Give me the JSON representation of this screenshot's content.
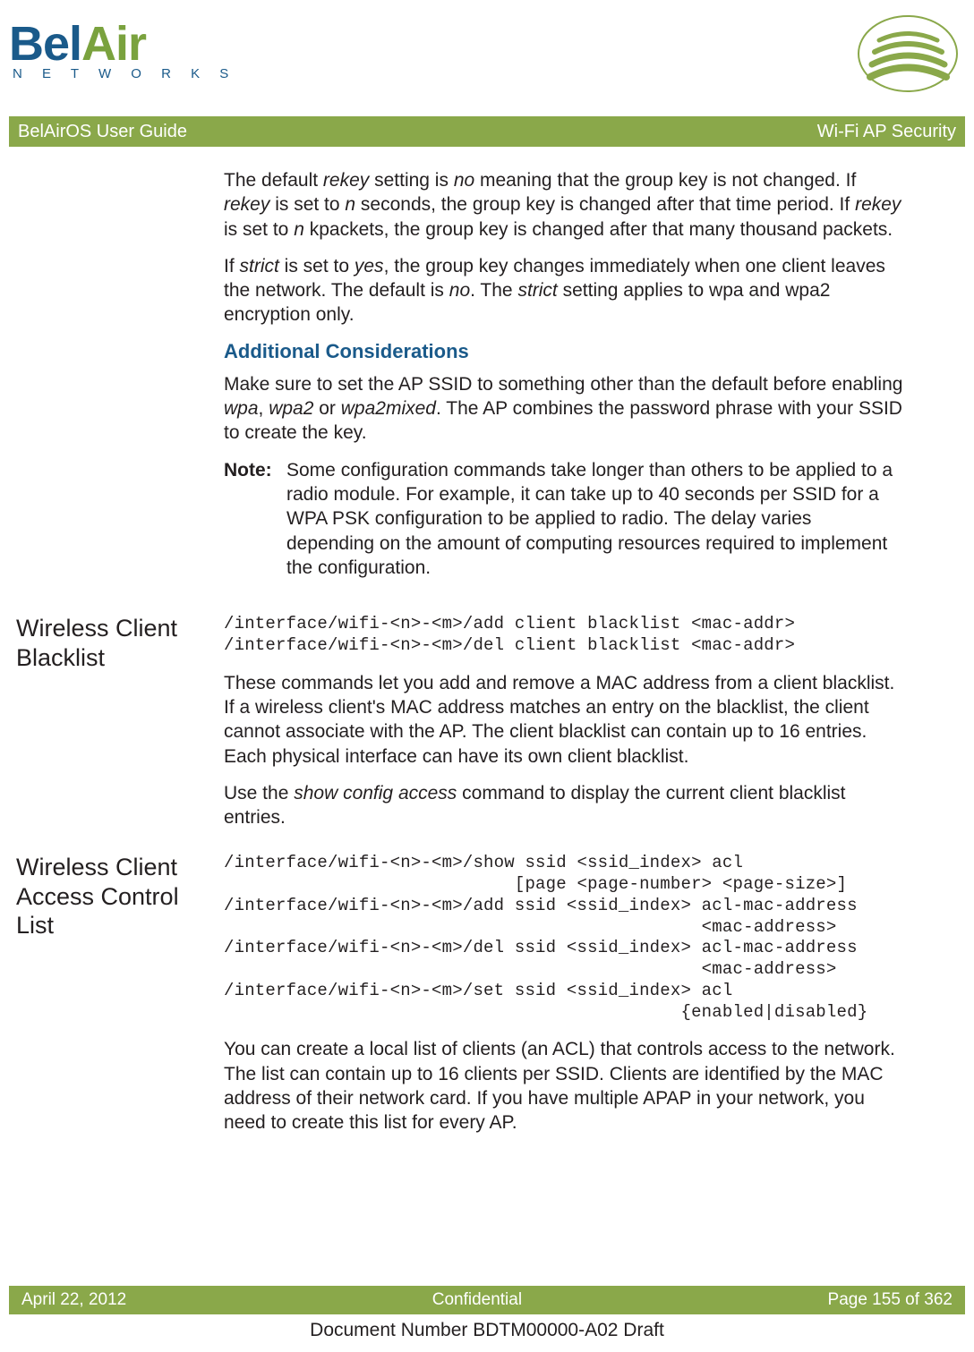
{
  "logo": {
    "bel": "Bel",
    "air": "Air",
    "networks": "N E T W O R K S"
  },
  "titleBar": {
    "left": "BelAirOS User Guide",
    "right": "Wi-Fi AP Security"
  },
  "intro": {
    "p1a": "The default ",
    "p1b": "rekey",
    "p1c": " setting is ",
    "p1d": "no",
    "p1e": " meaning that the group key is not changed. If ",
    "p1f": "rekey",
    "p1g": " is set to ",
    "p1h": "n",
    "p1i": " seconds, the group key is changed after that time period. If ",
    "p1j": "rekey",
    "p1k": " is set to ",
    "p1l": "n",
    "p1m": " kpackets, the group key is changed after that many thousand packets.",
    "p2a": "If ",
    "p2b": "strict",
    "p2c": " is set to ",
    "p2d": "yes",
    "p2e": ", the group key changes immediately when one client leaves the network. The default is ",
    "p2f": "no",
    "p2g": ". The ",
    "p2h": "strict",
    "p2i": " setting applies to wpa and wpa2 encryption only."
  },
  "additional": {
    "heading": "Additional Considerations",
    "p1a": "Make sure to set the AP SSID to something other than the default before enabling ",
    "p1b": "wpa",
    "p1c": ", ",
    "p1d": "wpa2",
    "p1e": " or ",
    "p1f": "wpa2mixed",
    "p1g": ". The AP combines the password phrase with your SSID to create the key.",
    "noteLabel": "Note:",
    "noteBody": "Some configuration commands take longer than others to be applied to a radio module. For example, it can take up to 40 seconds per SSID for a WPA PSK configuration to be applied to radio. The delay varies depending on the amount of computing resources required to implement the configuration."
  },
  "blacklist": {
    "heading": "Wireless Client Blacklist",
    "cmd": "/interface/wifi-<n>-<m>/add client blacklist <mac-addr>\n/interface/wifi-<n>-<m>/del client blacklist <mac-addr>",
    "p1": "These commands let you add and remove a MAC address from a client blacklist. If a wireless client's MAC address matches an entry on the blacklist, the client cannot associate with the AP. The client blacklist can contain up to 16 entries. Each physical interface can have its own client blacklist.",
    "p2a": "Use the ",
    "p2b": "show config access",
    "p2c": " command to display the current client blacklist entries."
  },
  "acl": {
    "heading": "Wireless Client Access Control List",
    "cmd": "/interface/wifi-<n>-<m>/show ssid <ssid_index> acl\n                            [page <page-number> <page-size>]\n/interface/wifi-<n>-<m>/add ssid <ssid_index> acl-mac-address\n                                              <mac-address>\n/interface/wifi-<n>-<m>/del ssid <ssid_index> acl-mac-address\n                                              <mac-address>\n/interface/wifi-<n>-<m>/set ssid <ssid_index> acl\n                                            {enabled|disabled}",
    "p1": "You can create a local list of clients (an ACL) that controls access to the network. The list can contain up to 16 clients per SSID. Clients are identified by the MAC address of their network card. If you have multiple APAP in your network, you need to create this list for every AP."
  },
  "footer": {
    "date": "April 22, 2012",
    "confidential": "Confidential",
    "page": "Page 155 of 362",
    "docnum": "Document Number BDTM00000-A02 Draft"
  }
}
